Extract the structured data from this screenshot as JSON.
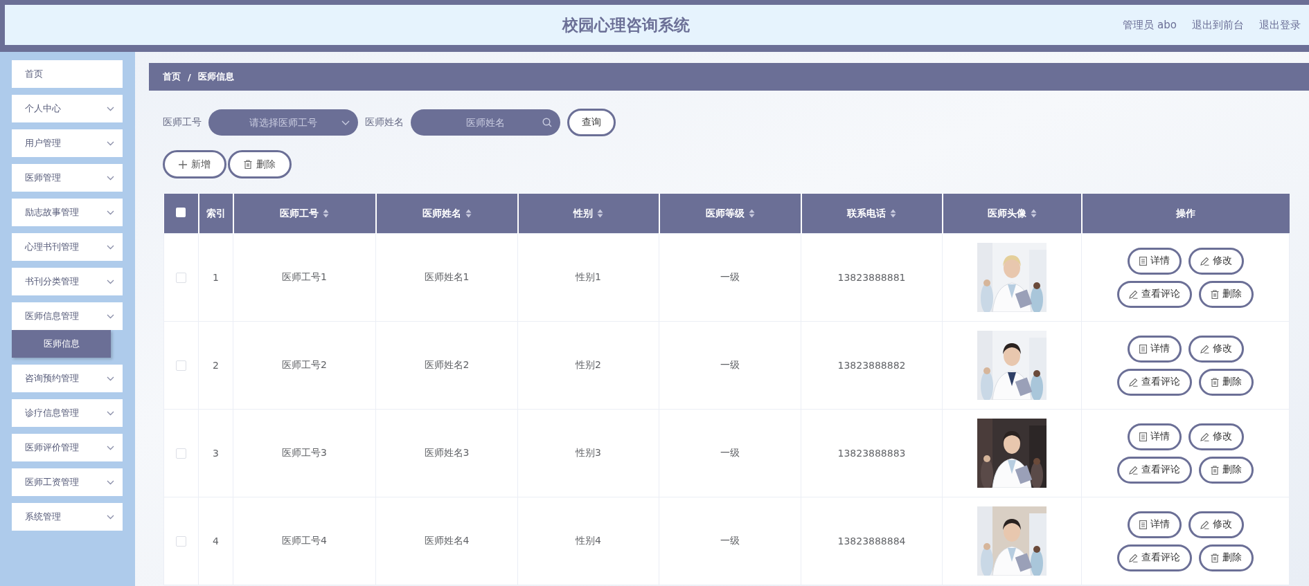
{
  "header": {
    "title": "校园心理咨询系统",
    "links": [
      "管理员 abo",
      "退出到前台",
      "退出登录"
    ]
  },
  "sidebar": {
    "items": [
      {
        "label": "首页",
        "kind": "link"
      },
      {
        "label": "个人中心",
        "kind": "menu"
      },
      {
        "label": "用户管理",
        "kind": "menu"
      },
      {
        "label": "医师管理",
        "kind": "menu"
      },
      {
        "label": "励志故事管理",
        "kind": "menu"
      },
      {
        "label": "心理书刊管理",
        "kind": "menu"
      },
      {
        "label": "书刊分类管理",
        "kind": "menu"
      },
      {
        "label": "医师信息管理",
        "kind": "menu",
        "children": [
          {
            "label": "医师信息",
            "selected": true
          }
        ]
      },
      {
        "label": "咨询预约管理",
        "kind": "menu"
      },
      {
        "label": "诊疗信息管理",
        "kind": "menu"
      },
      {
        "label": "医师评价管理",
        "kind": "menu"
      },
      {
        "label": "医师工资管理",
        "kind": "menu"
      },
      {
        "label": "系统管理",
        "kind": "menu"
      }
    ]
  },
  "breadcrumb": [
    "首页",
    "/",
    "医师信息"
  ],
  "search": {
    "fields": [
      {
        "label": "医师工号",
        "kind": "select",
        "placeholder": "请选择医师工号"
      },
      {
        "label": "医师姓名",
        "kind": "input",
        "placeholder": "医师姓名"
      }
    ],
    "button": "查询"
  },
  "actions": [
    {
      "label": "新增",
      "kind": "add"
    },
    {
      "label": "删除",
      "kind": "delete"
    }
  ],
  "table": {
    "select_all": {
      "checked": false
    },
    "columns": [
      {
        "label": "索引",
        "sortable": false
      },
      {
        "label": "医师工号",
        "sortable": true
      },
      {
        "label": "医师姓名",
        "sortable": true
      },
      {
        "label": "性别",
        "sortable": true
      },
      {
        "label": "医师等级",
        "sortable": true
      },
      {
        "label": "联系电话",
        "sortable": true
      },
      {
        "label": "医师头像",
        "sortable": true
      },
      {
        "label": "操作",
        "sortable": false
      }
    ],
    "rows": [
      {
        "checked": false,
        "cells": [
          "1",
          "医师工号1",
          "医师姓名1",
          "性别1",
          "一级",
          "13823888881"
        ],
        "buttons": [
          {
            "label": "详情",
            "kind": "detail"
          },
          {
            "label": "修改",
            "kind": "edit"
          },
          {
            "label": "查看评论",
            "kind": "edit"
          },
          {
            "label": "删除",
            "kind": "delete"
          }
        ]
      },
      {
        "checked": false,
        "cells": [
          "2",
          "医师工号2",
          "医师姓名2",
          "性别2",
          "一级",
          "13823888882"
        ],
        "buttons": [
          {
            "label": "详情",
            "kind": "detail"
          },
          {
            "label": "修改",
            "kind": "edit"
          },
          {
            "label": "查看评论",
            "kind": "edit"
          },
          {
            "label": "删除",
            "kind": "delete"
          }
        ]
      },
      {
        "checked": false,
        "cells": [
          "3",
          "医师工号3",
          "医师姓名3",
          "性别3",
          "一级",
          "13823888883"
        ],
        "buttons": [
          {
            "label": "详情",
            "kind": "detail"
          },
          {
            "label": "修改",
            "kind": "edit"
          },
          {
            "label": "查看评论",
            "kind": "edit"
          },
          {
            "label": "删除",
            "kind": "delete"
          }
        ]
      },
      {
        "checked": false,
        "cells": [
          "4",
          "医师工号4",
          "医师姓名4",
          "性别4",
          "一级",
          "13823888884"
        ],
        "buttons": [
          {
            "label": "详情",
            "kind": "detail"
          },
          {
            "label": "修改",
            "kind": "edit"
          },
          {
            "label": "查看评论",
            "kind": "edit"
          },
          {
            "label": "删除",
            "kind": "delete"
          }
        ]
      }
    ]
  }
}
